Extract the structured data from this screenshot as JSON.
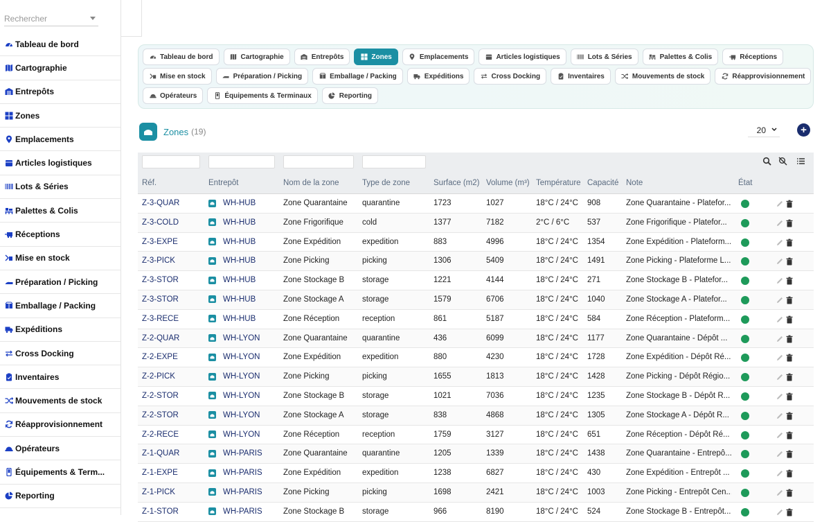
{
  "search": {
    "placeholder": "Rechercher"
  },
  "sidebar": {
    "items": [
      {
        "label": "Tableau de bord",
        "icon": "dashboard-icon"
      },
      {
        "label": "Cartographie",
        "icon": "map-icon"
      },
      {
        "label": "Entrepôts",
        "icon": "warehouse-icon"
      },
      {
        "label": "Zones",
        "icon": "grid-icon"
      },
      {
        "label": "Emplacements",
        "icon": "location-pin-icon"
      },
      {
        "label": "Articles logistiques",
        "icon": "box-icon"
      },
      {
        "label": "Lots & Séries",
        "icon": "barcode-icon"
      },
      {
        "label": "Palettes & Colis",
        "icon": "pallet-icon"
      },
      {
        "label": "Réceptions",
        "icon": "truck-receive-icon"
      },
      {
        "label": "Mise en stock",
        "icon": "putaway-icon"
      },
      {
        "label": "Préparation / Picking",
        "icon": "picking-icon"
      },
      {
        "label": "Emballage / Packing",
        "icon": "packing-icon"
      },
      {
        "label": "Expéditions",
        "icon": "truck-icon"
      },
      {
        "label": "Cross Docking",
        "icon": "swap-icon"
      },
      {
        "label": "Inventaires",
        "icon": "clipboard-icon"
      },
      {
        "label": "Mouvements de stock",
        "icon": "shuffle-icon"
      },
      {
        "label": "Réapprovisionnement",
        "icon": "refresh-icon"
      },
      {
        "label": "Opérateurs",
        "icon": "worker-icon"
      },
      {
        "label": "Équipements & Term...",
        "icon": "device-icon"
      },
      {
        "label": "Reporting",
        "icon": "pie-chart-icon"
      }
    ]
  },
  "tabs": {
    "row1": [
      {
        "label": "Tableau de bord",
        "icon": "dashboard-icon"
      },
      {
        "label": "Cartographie",
        "icon": "map-icon"
      },
      {
        "label": "Entrepôts",
        "icon": "warehouse-icon"
      },
      {
        "label": "Zones",
        "icon": "grid-icon",
        "active": true
      },
      {
        "label": "Emplacements",
        "icon": "location-pin-icon"
      },
      {
        "label": "Articles logistiques",
        "icon": "box-icon"
      },
      {
        "label": "Lots & Séries",
        "icon": "barcode-icon"
      },
      {
        "label": "Palettes & Colis",
        "icon": "pallet-icon"
      },
      {
        "label": "Réceptions",
        "icon": "truck-receive-icon"
      }
    ],
    "row2": [
      {
        "label": "Mise en stock",
        "icon": "putaway-icon"
      },
      {
        "label": "Préparation / Picking",
        "icon": "picking-icon"
      },
      {
        "label": "Emballage / Packing",
        "icon": "packing-icon"
      },
      {
        "label": "Expéditions",
        "icon": "truck-icon"
      },
      {
        "label": "Cross Docking",
        "icon": "swap-icon"
      },
      {
        "label": "Inventaires",
        "icon": "clipboard-icon"
      },
      {
        "label": "Mouvements de stock",
        "icon": "shuffle-icon"
      },
      {
        "label": "Réapprovisionnement",
        "icon": "refresh-icon"
      }
    ],
    "row3": [
      {
        "label": "Opérateurs",
        "icon": "worker-icon"
      },
      {
        "label": "Équipements & Terminaux",
        "icon": "device-icon"
      },
      {
        "label": "Reporting",
        "icon": "pie-chart-icon"
      }
    ]
  },
  "page": {
    "title": "Zones",
    "count": "(19)",
    "page_size": "20"
  },
  "table": {
    "columns": [
      "Réf.",
      "Entrepôt",
      "Nom de la zone",
      "Type de zone",
      "Surface (m2)",
      "Volume (m³)",
      "Température",
      "Capacité",
      "Note",
      "État"
    ],
    "status_color": "#1e9a5a",
    "rows": [
      [
        "Z-3-QUAR",
        "WH-HUB",
        "Zone Quarantaine",
        "quarantine",
        "1723",
        "1027",
        "18°C / 24°C",
        "908",
        "Zone Quarantaine - Platefor..."
      ],
      [
        "Z-3-COLD",
        "WH-HUB",
        "Zone Frigorifique",
        "cold",
        "1377",
        "7182",
        "2°C / 6°C",
        "537",
        "Zone Frigorifique - Platefor..."
      ],
      [
        "Z-3-EXPE",
        "WH-HUB",
        "Zone Expédition",
        "expedition",
        "883",
        "4996",
        "18°C / 24°C",
        "1354",
        "Zone Expédition - Plateform..."
      ],
      [
        "Z-3-PICK",
        "WH-HUB",
        "Zone Picking",
        "picking",
        "1306",
        "5409",
        "18°C / 24°C",
        "1491",
        "Zone Picking - Plateforme L..."
      ],
      [
        "Z-3-STOR",
        "WH-HUB",
        "Zone Stockage B",
        "storage",
        "1221",
        "4144",
        "18°C / 24°C",
        "271",
        "Zone Stockage B - Platefor..."
      ],
      [
        "Z-3-STOR",
        "WH-HUB",
        "Zone Stockage A",
        "storage",
        "1579",
        "6706",
        "18°C / 24°C",
        "1040",
        "Zone Stockage A - Platefor..."
      ],
      [
        "Z-3-RECE",
        "WH-HUB",
        "Zone Réception",
        "reception",
        "861",
        "5187",
        "18°C / 24°C",
        "584",
        "Zone Réception - Plateform..."
      ],
      [
        "Z-2-QUAR",
        "WH-LYON",
        "Zone Quarantaine",
        "quarantine",
        "436",
        "6099",
        "18°C / 24°C",
        "1177",
        "Zone Quarantaine - Dépôt ..."
      ],
      [
        "Z-2-EXPE",
        "WH-LYON",
        "Zone Expédition",
        "expedition",
        "880",
        "4230",
        "18°C / 24°C",
        "1728",
        "Zone Expédition - Dépôt Ré..."
      ],
      [
        "Z-2-PICK",
        "WH-LYON",
        "Zone Picking",
        "picking",
        "1655",
        "1813",
        "18°C / 24°C",
        "1428",
        "Zone Picking - Dépôt Régio..."
      ],
      [
        "Z-2-STOR",
        "WH-LYON",
        "Zone Stockage B",
        "storage",
        "1021",
        "7036",
        "18°C / 24°C",
        "1235",
        "Zone Stockage B - Dépôt R..."
      ],
      [
        "Z-2-STOR",
        "WH-LYON",
        "Zone Stockage A",
        "storage",
        "838",
        "4868",
        "18°C / 24°C",
        "1305",
        "Zone Stockage A - Dépôt R..."
      ],
      [
        "Z-2-RECE",
        "WH-LYON",
        "Zone Réception",
        "reception",
        "1759",
        "3127",
        "18°C / 24°C",
        "651",
        "Zone Réception - Dépôt Ré..."
      ],
      [
        "Z-1-QUAR",
        "WH-PARIS",
        "Zone Quarantaine",
        "quarantine",
        "1205",
        "1339",
        "18°C / 24°C",
        "1438",
        "Zone Quarantaine - Entrepô..."
      ],
      [
        "Z-1-EXPE",
        "WH-PARIS",
        "Zone Expédition",
        "expedition",
        "1238",
        "6827",
        "18°C / 24°C",
        "430",
        "Zone Expédition - Entrepôt ..."
      ],
      [
        "Z-1-PICK",
        "WH-PARIS",
        "Zone Picking",
        "picking",
        "1698",
        "2421",
        "18°C / 24°C",
        "1003",
        "Zone Picking - Entrepôt Cen..."
      ],
      [
        "Z-1-STOR",
        "WH-PARIS",
        "Zone Stockage B",
        "storage",
        "966",
        "8190",
        "18°C / 24°C",
        "524",
        "Zone Stockage B - Entrepôt..."
      ]
    ]
  }
}
